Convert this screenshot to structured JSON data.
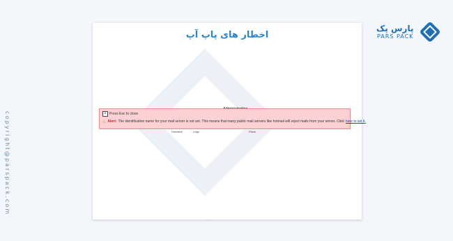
{
  "page": {
    "title": "اخطار های پاپ آپ",
    "copyright": "copyright@parspack.com"
  },
  "logo": {
    "name_fa": "پارس پک",
    "name_en": "PARS PACK"
  },
  "alert": {
    "close_hint": "Press Esc to close",
    "label": "Alert:",
    "message": "The identification name for your mail server is not set. This means that many public mail servers like hotmail will reject mails from your server. Click",
    "link": "here to set it."
  },
  "behind": {
    "heading": "Administration",
    "tabs": [
      "Domains",
      "Logs",
      "Plans"
    ]
  },
  "colors": {
    "accent": "#2a86c6",
    "alert_bg": "#fbd1d3",
    "alert_border": "#e58a8f"
  }
}
